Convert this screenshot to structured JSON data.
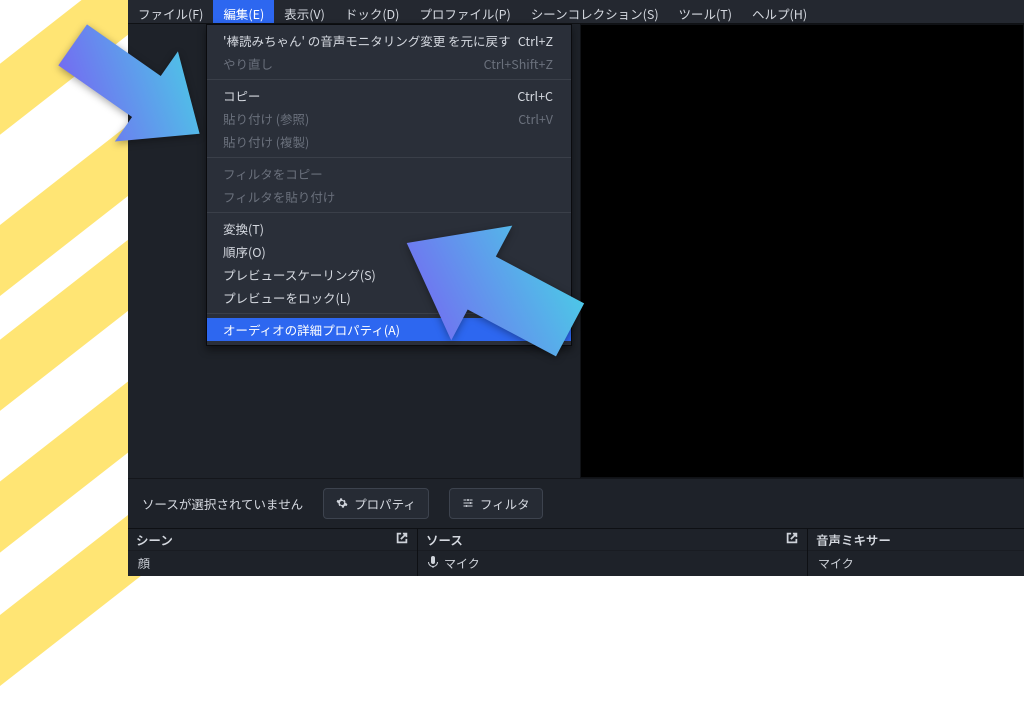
{
  "menubar": {
    "items": [
      "ファイル(F)",
      "編集(E)",
      "表示(V)",
      "ドック(D)",
      "プロファイル(P)",
      "シーンコレクション(S)",
      "ツール(T)",
      "ヘルプ(H)"
    ],
    "active_index": 1
  },
  "edit_menu": {
    "groups": [
      [
        {
          "label": "'棒読みちゃん' の音声モニタリング変更 を元に戻す",
          "shortcut": "Ctrl+Z",
          "enabled": true
        },
        {
          "label": "やり直し",
          "shortcut": "Ctrl+Shift+Z",
          "enabled": false
        }
      ],
      [
        {
          "label": "コピー",
          "shortcut": "Ctrl+C",
          "enabled": true
        },
        {
          "label": "貼り付け (参照)",
          "shortcut": "Ctrl+V",
          "enabled": false
        },
        {
          "label": "貼り付け (複製)",
          "shortcut": "",
          "enabled": false
        }
      ],
      [
        {
          "label": "フィルタをコピー",
          "shortcut": "",
          "enabled": false
        },
        {
          "label": "フィルタを貼り付け",
          "shortcut": "",
          "enabled": false
        }
      ],
      [
        {
          "label": "変換(T)",
          "shortcut": "",
          "enabled": true
        },
        {
          "label": "順序(O)",
          "shortcut": "",
          "enabled": true
        },
        {
          "label": "プレビュースケーリング(S)",
          "shortcut": "",
          "enabled": true
        },
        {
          "label": "プレビューをロック(L)",
          "shortcut": "",
          "enabled": true
        }
      ],
      [
        {
          "label": "オーディオの詳細プロパティ(A)",
          "shortcut": "",
          "enabled": true,
          "highlight": true
        }
      ]
    ]
  },
  "controls": {
    "no_source_text": "ソースが選択されていません",
    "properties_btn": "プロパティ",
    "filters_btn": "フィルタ"
  },
  "panels": {
    "scenes": {
      "title": "シーン",
      "first_item": "顔"
    },
    "sources": {
      "title": "ソース",
      "first_item": "マイク"
    },
    "mixer": {
      "title": "音声ミキサー",
      "first_item": "マイク"
    }
  }
}
